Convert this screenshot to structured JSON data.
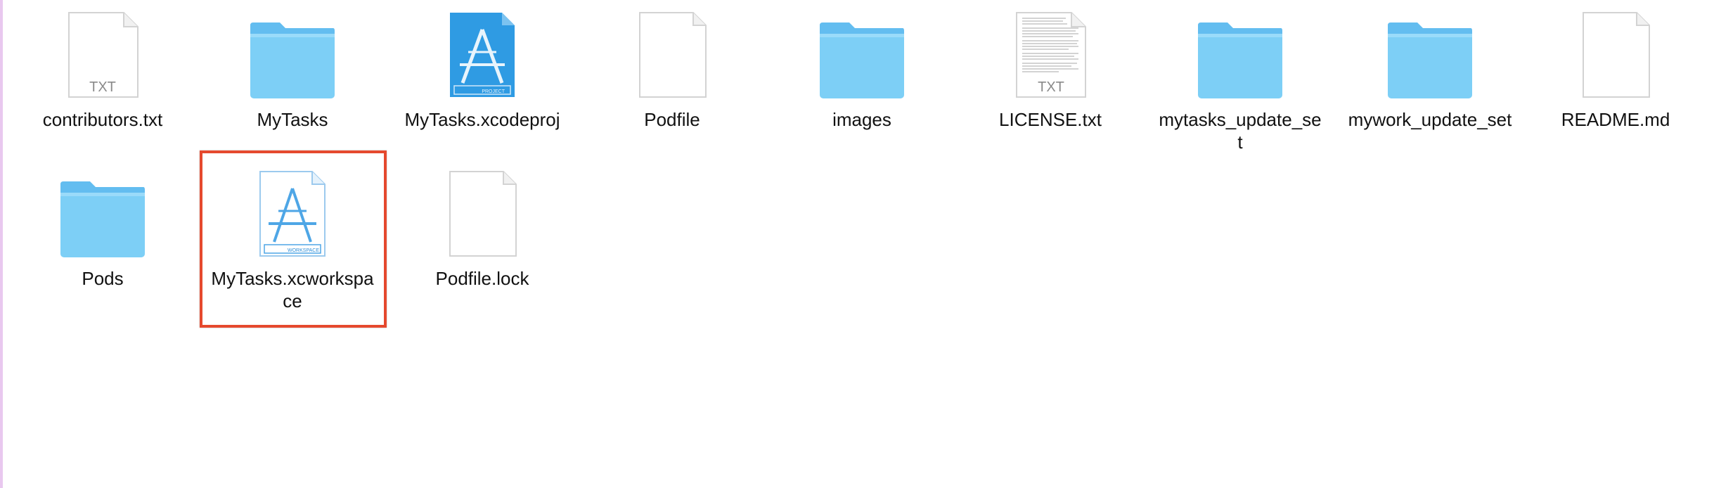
{
  "window": {
    "view": "icon-view"
  },
  "colors": {
    "folder": "#7dcff6",
    "folder_dark": "#5ab8ea",
    "xcode_blue": "#2f9be3",
    "selection": "#e5492e"
  },
  "rows": [
    {
      "items": [
        {
          "name": "contributors.txt",
          "icon": "text-document-icon",
          "badge": "TXT"
        },
        {
          "name": "MyTasks",
          "icon": "folder-icon"
        },
        {
          "name": "MyTasks.xcodeproj",
          "icon": "xcode-project-icon",
          "badge": "PROJECT"
        },
        {
          "name": "Podfile",
          "icon": "blank-document-icon"
        },
        {
          "name": "images",
          "icon": "folder-icon"
        },
        {
          "name": "LICENSE.txt",
          "icon": "license-document-icon",
          "badge": "TXT"
        },
        {
          "name": "mytasks_update_set",
          "icon": "folder-icon"
        },
        {
          "name": "mywork_update_set",
          "icon": "folder-icon"
        },
        {
          "name": "README.md",
          "icon": "blank-document-icon"
        }
      ]
    },
    {
      "items": [
        {
          "name": "Pods",
          "icon": "folder-icon"
        },
        {
          "name": "MyTasks.xcworkspace",
          "icon": "xcode-workspace-icon",
          "badge": "WORKSPACE",
          "selected": true
        },
        {
          "name": "Podfile.lock",
          "icon": "blank-document-icon"
        }
      ]
    }
  ]
}
